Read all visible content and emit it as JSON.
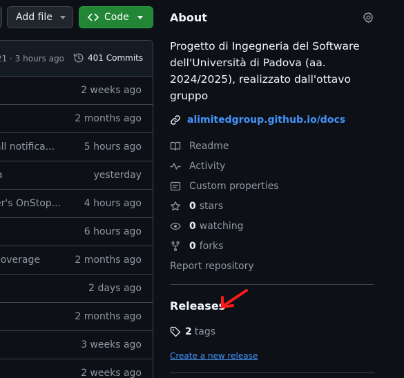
{
  "toolbar": {
    "add_file_label": "Add file",
    "code_label": "Code"
  },
  "commit_header": {
    "meta": "21 · 3 hours ago",
    "commits_label": "401 Commits"
  },
  "files": [
    {
      "message": "",
      "age": "2 weeks ago"
    },
    {
      "message": "",
      "age": "2 months ago"
    },
    {
      "message": "all notifica...",
      "age": "5 hours ago"
    },
    {
      "message": "a",
      "age": "yesterday"
    },
    {
      "message": "er's OnStop...",
      "age": "4 hours ago"
    },
    {
      "message": "",
      "age": "6 hours ago"
    },
    {
      "message": "coverage",
      "age": "2 months ago"
    },
    {
      "message": "",
      "age": "2 days ago"
    },
    {
      "message": "",
      "age": "2 months ago"
    },
    {
      "message": "",
      "age": "3 weeks ago"
    },
    {
      "message": "",
      "age": "2 weeks ago"
    }
  ],
  "about": {
    "title": "About",
    "description": "Progetto di Ingegneria del Software dell'Università di Padova (aa. 2024/2025), realizzato dall'ottavo gruppo",
    "homepage": "alimitedgroup.github.io/docs",
    "readme": "Readme",
    "activity": "Activity",
    "custom_properties": "Custom properties",
    "stars_count": "0",
    "stars_label": "stars",
    "watching_count": "0",
    "watching_label": "watching",
    "forks_count": "0",
    "forks_label": "forks",
    "report": "Report repository"
  },
  "releases": {
    "title": "Releases",
    "tags_count": "2",
    "tags_label": "tags",
    "create_label": "Create a new release"
  },
  "colors": {
    "background": "#0d1117",
    "link": "#4493f8",
    "code_button": "#238636",
    "annotation_arrow": "#ff1a1a"
  }
}
